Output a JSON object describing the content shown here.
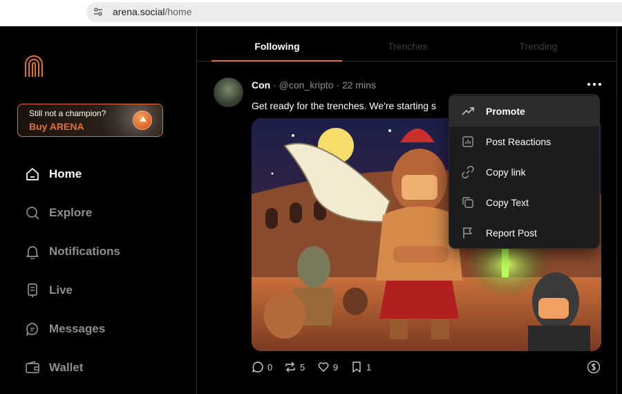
{
  "browser": {
    "url_host": "arena.social",
    "url_path": "/home"
  },
  "sidebar": {
    "promo": {
      "line1": "Still not a champion?",
      "line2": "Buy ARENA"
    },
    "items": [
      {
        "label": "Home",
        "icon": "home-icon",
        "active": true
      },
      {
        "label": "Explore",
        "icon": "search-icon",
        "active": false
      },
      {
        "label": "Notifications",
        "icon": "bell-icon",
        "active": false
      },
      {
        "label": "Live",
        "icon": "live-icon",
        "active": false
      },
      {
        "label": "Messages",
        "icon": "message-icon",
        "active": false
      },
      {
        "label": "Wallet",
        "icon": "wallet-icon",
        "active": false
      }
    ]
  },
  "tabs": [
    {
      "label": "Following",
      "active": true
    },
    {
      "label": "Trenches",
      "active": false
    },
    {
      "label": "Trending",
      "active": false
    }
  ],
  "post": {
    "author": "Con",
    "handle": "@con_kripto",
    "time": "22 mins",
    "text": "Get ready for the trenches. We're starting s",
    "stats": {
      "comments": "0",
      "reposts": "5",
      "likes": "9",
      "bookmarks": "1"
    }
  },
  "menu": {
    "items": [
      {
        "label": "Promote",
        "icon": "trend-up-icon",
        "highlighted": true
      },
      {
        "label": "Post Reactions",
        "icon": "bar-chart-icon",
        "highlighted": false
      },
      {
        "label": "Copy link",
        "icon": "link-icon",
        "highlighted": false
      },
      {
        "label": "Copy Text",
        "icon": "copy-icon",
        "highlighted": false
      },
      {
        "label": "Report Post",
        "icon": "flag-icon",
        "highlighted": false
      }
    ]
  },
  "colors": {
    "accent": "#e8702a",
    "background": "#000000",
    "muted_text": "#8e8e93",
    "menu_bg": "#1c1c1e"
  }
}
